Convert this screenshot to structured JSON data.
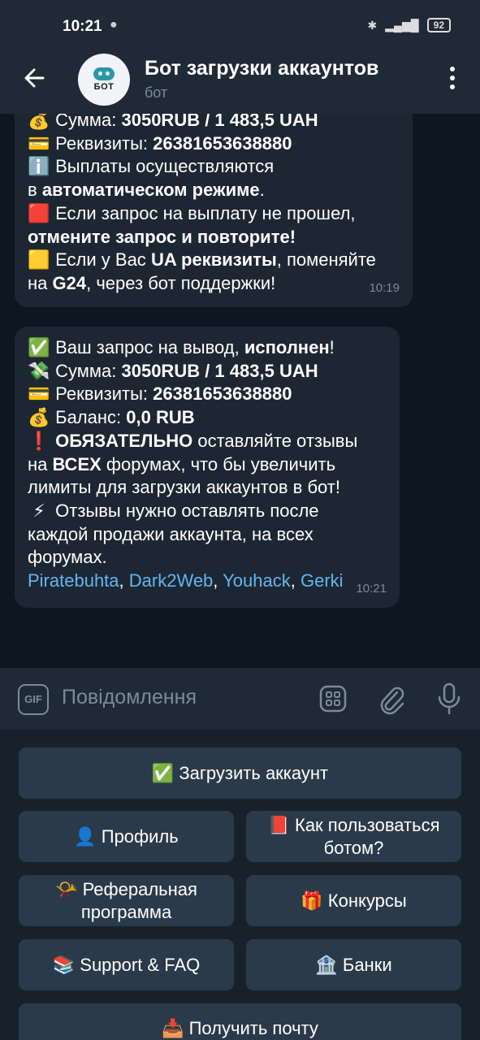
{
  "status": {
    "time": "10:21",
    "battery": "92"
  },
  "header": {
    "avatar_text": "БОТ",
    "title": "Бот загрузки аккаунтов",
    "subtitle": "бот"
  },
  "messages": [
    {
      "lines": [
        {
          "emoji": "💰",
          "parts": [
            {
              "t": "Сумма: "
            },
            {
              "t": "3050RUB  / 1 483,5 UAH",
              "b": true
            }
          ]
        },
        {
          "emoji": "💳",
          "parts": [
            {
              "t": "Реквизиты: "
            },
            {
              "t": "26381653638880",
              "b": true
            }
          ]
        },
        {
          "emoji": "ℹ️",
          "parts": [
            {
              "t": "Выплаты осуществляются"
            }
          ]
        },
        {
          "emoji": "",
          "parts": [
            {
              "t": "в "
            },
            {
              "t": "автоматическом режиме",
              "b": true
            },
            {
              "t": "."
            }
          ]
        },
        {
          "emoji": "",
          "parts": [
            {
              "t": " "
            }
          ]
        },
        {
          "emoji": "🟥",
          "parts": [
            {
              "t": "Если запрос на выплату не прошел,"
            }
          ]
        },
        {
          "emoji": "",
          "parts": [
            {
              "t": "отмените запрос и повторите!",
              "b": true
            }
          ]
        },
        {
          "emoji": "🟨",
          "parts": [
            {
              "t": "Если у Вас "
            },
            {
              "t": "UA реквизиты",
              "b": true
            },
            {
              "t": ", поменяйте"
            }
          ]
        },
        {
          "emoji": "",
          "parts": [
            {
              "t": "на "
            },
            {
              "t": "G24",
              "b": true
            },
            {
              "t": ", через бот поддержки!"
            }
          ]
        }
      ],
      "time": "10:19"
    },
    {
      "lines": [
        {
          "emoji": "✅",
          "parts": [
            {
              "t": "Ваш запрос на вывод, "
            },
            {
              "t": "исполнен",
              "b": true
            },
            {
              "t": "!"
            }
          ]
        },
        {
          "emoji": "💸",
          "parts": [
            {
              "t": "Сумма: "
            },
            {
              "t": "3050RUB  / 1 483,5 UAH",
              "b": true
            }
          ]
        },
        {
          "emoji": "💳",
          "parts": [
            {
              "t": "Реквизиты: "
            },
            {
              "t": "26381653638880",
              "b": true
            }
          ]
        },
        {
          "emoji": "",
          "parts": [
            {
              "t": " "
            }
          ]
        },
        {
          "emoji": "💰",
          "parts": [
            {
              "t": "Баланс: "
            },
            {
              "t": "0,0 RUB",
              "b": true
            }
          ]
        },
        {
          "emoji": "",
          "parts": [
            {
              "t": " "
            }
          ]
        },
        {
          "emoji": "❗",
          "parts": [
            {
              "t": "ОБЯЗАТЕЛЬНО",
              "b": true
            },
            {
              "t": " оставляйте отзывы"
            }
          ]
        },
        {
          "emoji": "",
          "parts": [
            {
              "t": "на "
            },
            {
              "t": "ВСЕХ",
              "b": true
            },
            {
              "t": " форумах, что бы увеличить"
            }
          ]
        },
        {
          "emoji": "",
          "parts": [
            {
              "t": "лимиты для загрузки аккаунтов в бот!"
            }
          ]
        },
        {
          "emoji": "⚡",
          "parts": [
            {
              "t": "Отзывы нужно оставлять после"
            }
          ]
        },
        {
          "emoji": "",
          "parts": [
            {
              "t": "каждой продажи аккаунта, на всех"
            }
          ]
        },
        {
          "emoji": "",
          "parts": [
            {
              "t": "форумах."
            }
          ]
        },
        {
          "emoji": "",
          "parts": [
            {
              "t": "Piratebuhta",
              "l": true
            },
            {
              "t": ", "
            },
            {
              "t": "Dark2Web",
              "l": true
            },
            {
              "t": ", "
            },
            {
              "t": "Youhack",
              "l": true
            },
            {
              "t": ", "
            },
            {
              "t": "Gerki",
              "l": true
            }
          ]
        }
      ],
      "time": "10:21"
    }
  ],
  "input": {
    "placeholder": "Повідомлення",
    "gif_label": "GIF"
  },
  "keyboard": {
    "upload": "✅ Загрузить аккаунт",
    "profile": "👤 Профиль",
    "howto_line1": "📕 Как пользоваться",
    "howto_line2": "ботом?",
    "referral_line1": "📯 Реферальная",
    "referral_line2": "программа",
    "contests": "🎁 Конкурсы",
    "support": "📚 Support & FAQ",
    "banks": "🏦 Банки",
    "mail": "📥 Получить почту"
  }
}
